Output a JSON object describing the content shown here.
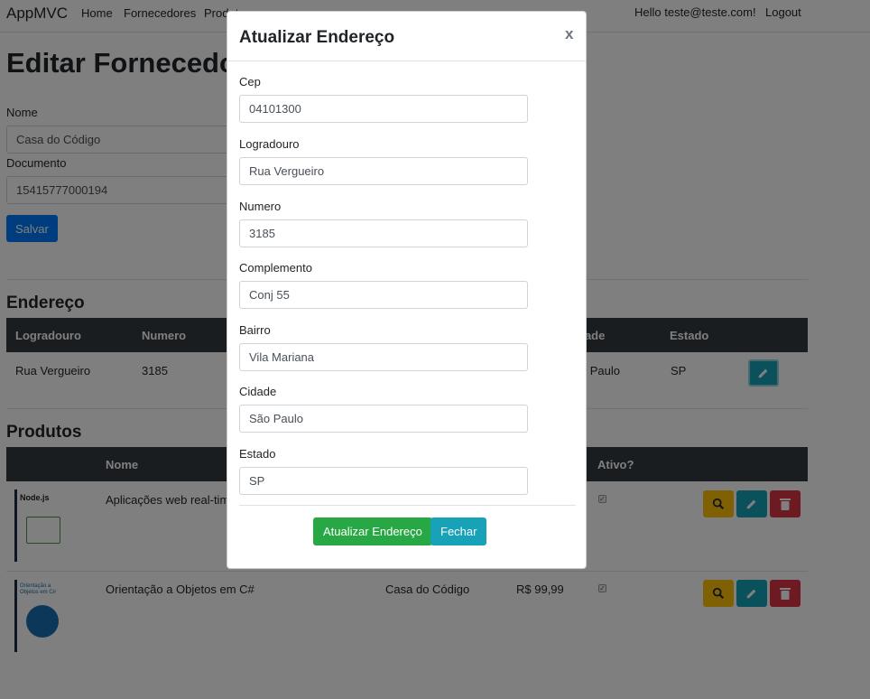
{
  "navbar": {
    "brand": "AppMVC",
    "links": [
      "Home",
      "Fornecedores",
      "Produtos"
    ],
    "greeting": "Hello teste@teste.com!",
    "logout": "Logout"
  },
  "page": {
    "title": "Editar Fornecedor",
    "nome_label": "Nome",
    "nome_value": "Casa do Código",
    "documento_label": "Documento",
    "documento_value": "15415777000194",
    "save_label": "Salvar"
  },
  "endereco": {
    "title": "Endereço",
    "headers": [
      "Logradouro",
      "Numero",
      "Cidade",
      "Estado"
    ],
    "row": {
      "logradouro": "Rua Vergueiro",
      "numero": "3185",
      "cidade": "São Paulo",
      "estado": "SP"
    }
  },
  "produtos": {
    "title": "Produtos",
    "headers": [
      "Nome",
      "Ativo?"
    ],
    "rows": [
      {
        "nome": "Aplicações web real-time com Node.js",
        "fornecedor": "",
        "valor": "",
        "cover": "Node.js"
      },
      {
        "nome": "Orientação a Objetos em C#",
        "fornecedor": "Casa do Código",
        "valor": "R$ 99,99",
        "cover": "Orientação a Objetos em C#"
      }
    ]
  },
  "modal": {
    "title": "Atualizar Endereço",
    "close": "x",
    "fields": [
      {
        "label": "Cep",
        "value": "04101300"
      },
      {
        "label": "Logradouro",
        "value": "Rua Vergueiro"
      },
      {
        "label": "Numero",
        "value": "3185"
      },
      {
        "label": "Complemento",
        "value": "Conj 55"
      },
      {
        "label": "Bairro",
        "value": "Vila Mariana"
      },
      {
        "label": "Cidade",
        "value": "São Paulo"
      },
      {
        "label": "Estado",
        "value": "SP"
      }
    ],
    "submit": "Atualizar Endereço",
    "cancel": "Fechar"
  },
  "colors": {
    "primary": "#007bff",
    "success": "#28a745",
    "info": "#17a2b8",
    "warning": "#ffc107",
    "danger": "#dc3545",
    "dark": "#343a40"
  },
  "icons": [
    "search-icon",
    "pencil-icon",
    "trash-icon"
  ]
}
